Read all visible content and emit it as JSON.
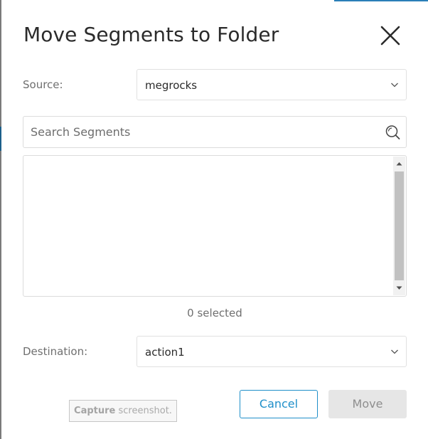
{
  "dialog": {
    "title": "Move Segments to Folder",
    "close_icon": "close-x-icon"
  },
  "source": {
    "label": "Source:",
    "value": "megrocks",
    "chevron_icon": "chevron-down-icon"
  },
  "search": {
    "placeholder": "Search Segments",
    "value": "",
    "icon": "search-icon"
  },
  "segment_list": {
    "items": [],
    "selected_text": "0 selected"
  },
  "destination": {
    "label": "Destination:",
    "value": "action1",
    "chevron_icon": "chevron-down-icon"
  },
  "buttons": {
    "cancel_label": "Cancel",
    "move_label": "Move"
  },
  "capture": {
    "strong": "Capture",
    "rest": "screenshot."
  },
  "colors": {
    "accent": "#1f8fc9",
    "title_text": "#2b2b2b",
    "label_text": "#6f6f6f",
    "disabled_button_bg": "#e6e6e6"
  }
}
